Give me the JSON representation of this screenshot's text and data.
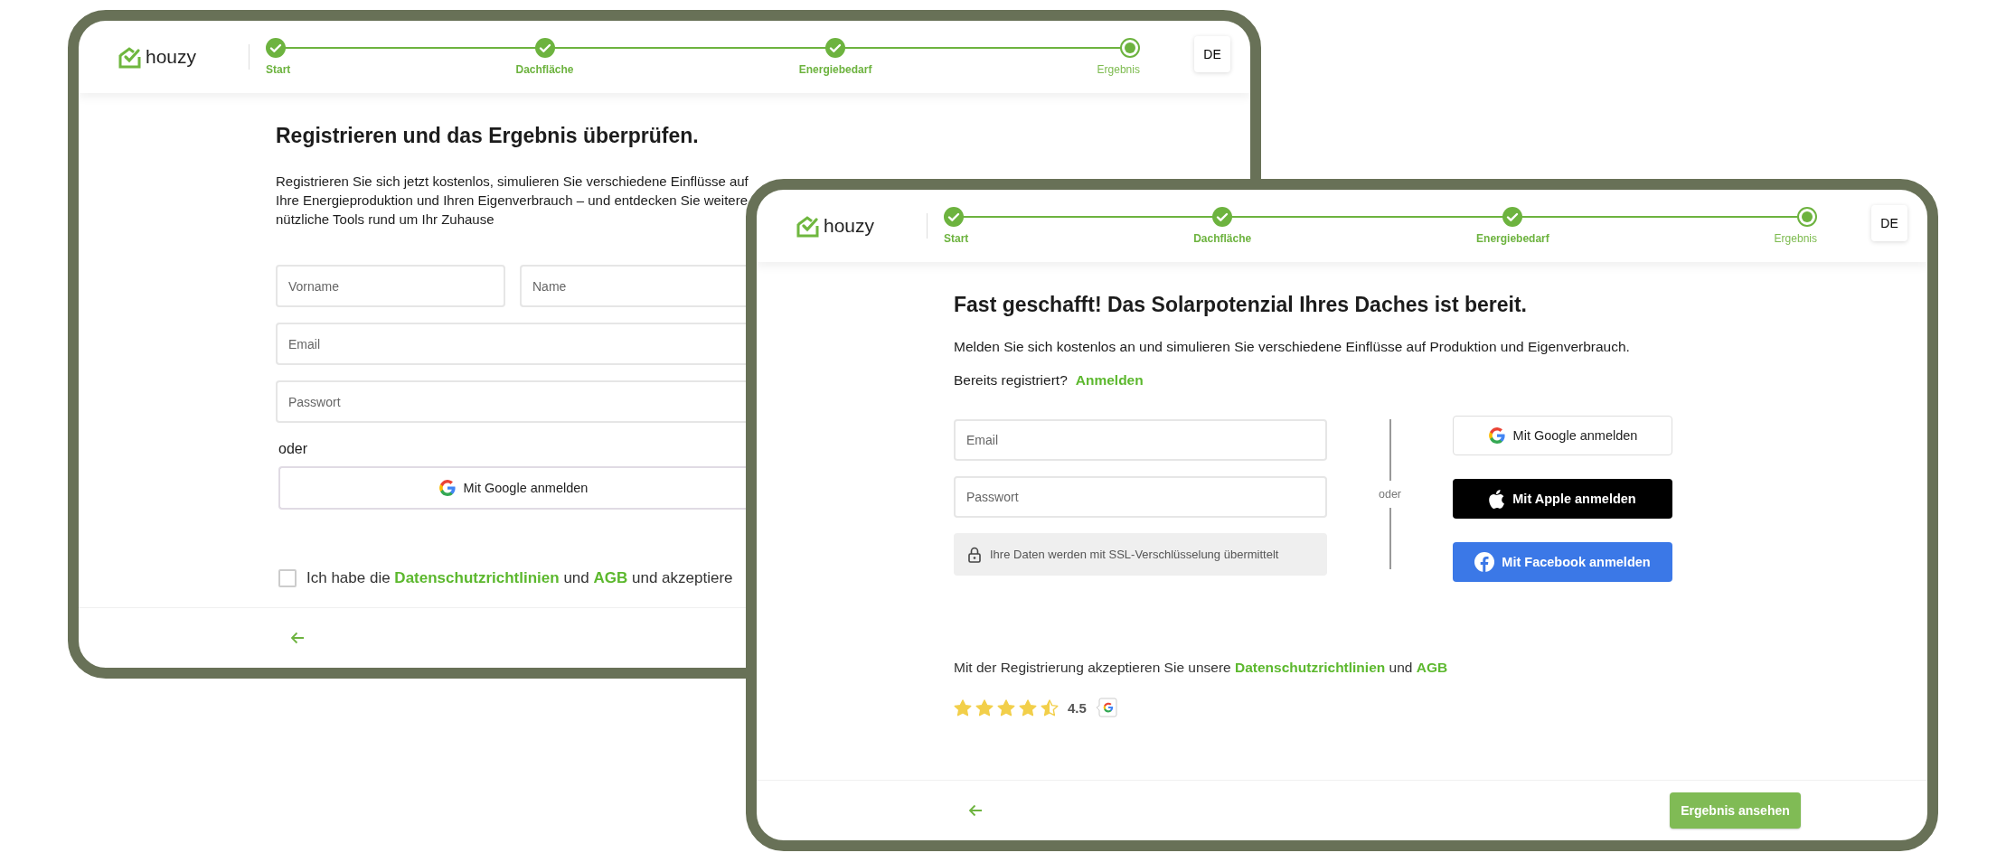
{
  "screens": [
    {
      "kind": "signup",
      "logo": "houzy",
      "language": "DE",
      "steps": [
        {
          "label": "Start",
          "completed": true,
          "current": false
        },
        {
          "label": "Dachfläche",
          "completed": true,
          "current": false
        },
        {
          "label": "Energiebedarf",
          "completed": true,
          "current": false
        },
        {
          "label": "Ergebnis",
          "completed": false,
          "current": true
        }
      ],
      "title": "Registrieren und das Ergebnis überprüfen.",
      "intro": "Registrieren Sie sich jetzt kostenlos, simulieren Sie verschiedene Einflüsse auf Ihre Energieproduktion und Ihren Eigenverbrauch – und entdecken Sie weitere nützliche Tools rund um Ihr Zuhause",
      "fields": [
        {
          "placeholder": "Vorname"
        },
        {
          "placeholder": "Name"
        },
        {
          "placeholder": "Email"
        },
        {
          "placeholder": "Passwort"
        }
      ],
      "separator": "oder",
      "social_buttons": [
        {
          "kind": "google",
          "label": "Mit Google anmelden"
        }
      ],
      "consent": {
        "checked": false,
        "text": "Ich habe die **Datenschutzrichtlinien** und **AGB** und akzeptiere"
      }
    },
    {
      "kind": "login",
      "logo": "houzy",
      "language": "DE",
      "steps": [
        {
          "label": "Start",
          "completed": true,
          "current": false
        },
        {
          "label": "Dachfläche",
          "completed": true,
          "current": false
        },
        {
          "label": "Energiebedarf",
          "completed": true,
          "current": false
        },
        {
          "label": "Ergebnis",
          "completed": false,
          "current": true
        }
      ],
      "title": "Fast geschafft! Das Solarpotenzial Ihres Daches ist bereit.",
      "intro": "Melden Sie sich kostenlos an und simulieren Sie verschiedene Einflüsse auf Produktion und Eigenverbrauch.",
      "login_prompt": {
        "text": "Bereits registriert?",
        "link": "Anmelden"
      },
      "fields": [
        {
          "placeholder": "Email"
        },
        {
          "placeholder": "Passwort"
        }
      ],
      "security_note": "Ihre Daten werden mit SSL-Verschlüsselung übermittelt",
      "separator": "oder",
      "social_buttons": [
        {
          "kind": "google",
          "label": "Mit Google anmelden"
        },
        {
          "kind": "apple",
          "label": "Mit Apple anmelden"
        },
        {
          "kind": "facebook",
          "label": "Mit Facebook anmelden"
        }
      ],
      "terms": "Mit der Registrierung akzeptieren Sie unsere **Datenschutzrichtlinien** und **AGB**",
      "rating": {
        "stars": 4.5,
        "value": "4.5"
      },
      "primary_button": "Ergebnis ansehen"
    }
  ]
}
